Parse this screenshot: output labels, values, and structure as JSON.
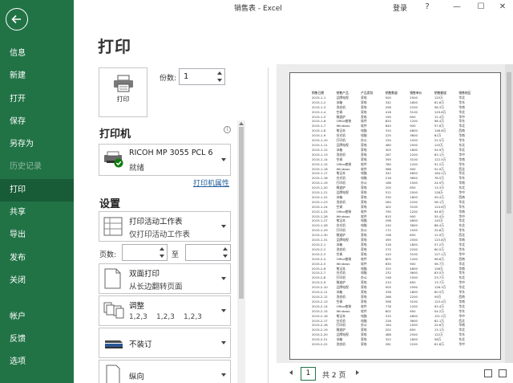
{
  "window": {
    "title": "销售表 - Excel",
    "login": "登录",
    "help": "?",
    "minimize": "—",
    "maximize": "☐",
    "close": "✕"
  },
  "nav": {
    "items": [
      {
        "label": "信息",
        "state": "normal"
      },
      {
        "label": "新建",
        "state": "normal"
      },
      {
        "label": "打开",
        "state": "normal"
      },
      {
        "label": "保存",
        "state": "normal"
      },
      {
        "label": "另存为",
        "state": "normal"
      },
      {
        "label": "历史记录",
        "state": "disabled"
      },
      {
        "label": "打印",
        "state": "active"
      },
      {
        "label": "共享",
        "state": "normal"
      },
      {
        "label": "导出",
        "state": "normal"
      },
      {
        "label": "发布",
        "state": "normal"
      },
      {
        "label": "关闭",
        "state": "normal"
      },
      {
        "label": "帐户",
        "state": "normal"
      },
      {
        "label": "反馈",
        "state": "normal"
      },
      {
        "label": "选项",
        "state": "normal"
      }
    ]
  },
  "print": {
    "heading": "打印",
    "button_label": "打印",
    "copies_label": "份数:",
    "copies_value": "1"
  },
  "printer": {
    "heading": "打印机",
    "info_glyph": "i",
    "name": "RICOH MP 3055 PCL 6",
    "status": "就绪",
    "properties_link": "打印机属性"
  },
  "settings": {
    "heading": "设置",
    "what": {
      "line1": "打印活动工作表",
      "line2": "仅打印活动工作表"
    },
    "pages_label": "页数:",
    "to_label": "至",
    "sides": {
      "line1": "双面打印",
      "line2": "从长边翻转页面"
    },
    "collate": {
      "line1": "调整",
      "nums": [
        "1,2,3",
        "1,2,3",
        "1,2,3"
      ]
    },
    "staple": {
      "line1": "不装订"
    },
    "orientation": {
      "line1": "纵向"
    }
  },
  "preview": {
    "current_page": "1",
    "total": "共 2 页",
    "headers": [
      "销售日期",
      "销售产品",
      "产品类别",
      "销售数量",
      "销售单价",
      "销售额度",
      "销售地区"
    ],
    "rows": [
      [
        "2015-1-1",
        "品牌电视",
        "家电",
        "500",
        "2500",
        "125万",
        "华北"
      ],
      [
        "2015-1-2",
        "冰箱",
        "家电",
        "342",
        "1800",
        "61.6万",
        "华东"
      ],
      [
        "2015-1-3",
        "洗衣机",
        "家电",
        "256",
        "2200",
        "56.3万",
        "华南"
      ],
      [
        "2015-1-4",
        "空调",
        "家电",
        "418",
        "3100",
        "129.6万",
        "华北"
      ],
      [
        "2015-1-5",
        "微波炉",
        "家电",
        "190",
        "650",
        "12.4万",
        "华中"
      ],
      [
        "2015-1-6",
        "Office套装",
        "软件",
        "820",
        "1200",
        "98.4万",
        "华东"
      ],
      [
        "2015-1-7",
        "Windows",
        "软件",
        "640",
        "900",
        "57.6万",
        "华北"
      ],
      [
        "2015-1-8",
        "笔记本",
        "电脑",
        "310",
        "4800",
        "148.8万",
        "西南"
      ],
      [
        "2015-1-9",
        "台式机",
        "电脑",
        "225",
        "3600",
        "81万",
        "华南"
      ],
      [
        "2015-1-10",
        "打印机",
        "办公",
        "150",
        "1500",
        "22.5万",
        "华东"
      ],
      [
        "2015-1-11",
        "品牌电视",
        "家电",
        "480",
        "2500",
        "120万",
        "东北"
      ],
      [
        "2015-1-12",
        "冰箱",
        "家电",
        "305",
        "1800",
        "54.9万",
        "华北"
      ],
      [
        "2015-1-13",
        "洗衣机",
        "家电",
        "287",
        "2200",
        "63.1万",
        "华中"
      ],
      [
        "2015-1-14",
        "空调",
        "家电",
        "395",
        "3100",
        "122.5万",
        "华南"
      ],
      [
        "2015-1-15",
        "Office套装",
        "软件",
        "760",
        "1200",
        "91.2万",
        "华东"
      ],
      [
        "2015-1-16",
        "Windows",
        "软件",
        "588",
        "900",
        "52.9万",
        "西北"
      ],
      [
        "2015-1-17",
        "笔记本",
        "电脑",
        "342",
        "4800",
        "164.2万",
        "华北"
      ],
      [
        "2015-1-18",
        "台式机",
        "电脑",
        "218",
        "3600",
        "78.5万",
        "华东"
      ],
      [
        "2015-1-19",
        "打印机",
        "办公",
        "166",
        "1500",
        "24.9万",
        "华南"
      ],
      [
        "2015-1-20",
        "微波炉",
        "家电",
        "205",
        "650",
        "13.3万",
        "东北"
      ],
      [
        "2015-1-21",
        "品牌电视",
        "家电",
        "512",
        "2500",
        "128万",
        "华中"
      ],
      [
        "2015-1-22",
        "冰箱",
        "家电",
        "330",
        "1800",
        "59.4万",
        "西南"
      ],
      [
        "2015-1-23",
        "洗衣机",
        "家电",
        "264",
        "2200",
        "58.1万",
        "华北"
      ],
      [
        "2015-1-24",
        "空调",
        "家电",
        "402",
        "3100",
        "124.6万",
        "华东"
      ],
      [
        "2015-1-25",
        "Office套装",
        "软件",
        "790",
        "1200",
        "94.8万",
        "华南"
      ],
      [
        "2015-1-26",
        "Windows",
        "软件",
        "615",
        "900",
        "55.4万",
        "华中"
      ],
      [
        "2015-1-27",
        "笔记本",
        "电脑",
        "298",
        "4800",
        "143万",
        "华北"
      ],
      [
        "2015-1-28",
        "台式机",
        "电脑",
        "240",
        "3600",
        "86.4万",
        "东北"
      ],
      [
        "2015-1-29",
        "打印机",
        "办公",
        "172",
        "1500",
        "25.8万",
        "华东"
      ],
      [
        "2015-1-30",
        "微波炉",
        "家电",
        "198",
        "650",
        "12.9万",
        "西北"
      ],
      [
        "2015-1-31",
        "品牌电视",
        "家电",
        "495",
        "2500",
        "123.8万",
        "华南"
      ],
      [
        "2015-2-1",
        "冰箱",
        "家电",
        "318",
        "1800",
        "57.2万",
        "华北"
      ],
      [
        "2015-2-2",
        "洗衣机",
        "家电",
        "275",
        "2200",
        "60.5万",
        "华东"
      ],
      [
        "2015-2-3",
        "空调",
        "家电",
        "410",
        "3100",
        "127.1万",
        "华中"
      ],
      [
        "2015-2-4",
        "Office套装",
        "软件",
        "805",
        "1200",
        "96.6万",
        "西南"
      ],
      [
        "2015-2-5",
        "Windows",
        "软件",
        "630",
        "900",
        "56.7万",
        "华北"
      ],
      [
        "2015-2-6",
        "笔记本",
        "电脑",
        "325",
        "4800",
        "156万",
        "华南"
      ],
      [
        "2015-2-7",
        "台式机",
        "电脑",
        "232",
        "3600",
        "83.5万",
        "华东"
      ],
      [
        "2015-2-8",
        "打印机",
        "办公",
        "158",
        "1500",
        "23.7万",
        "东北"
      ],
      [
        "2015-2-9",
        "微波炉",
        "家电",
        "210",
        "650",
        "13.7万",
        "华中"
      ],
      [
        "2015-2-10",
        "品牌电视",
        "家电",
        "505",
        "2500",
        "126.3万",
        "华北"
      ],
      [
        "2015-2-11",
        "冰箱",
        "家电",
        "336",
        "1800",
        "60.5万",
        "华东"
      ],
      [
        "2015-2-12",
        "洗衣机",
        "家电",
        "268",
        "2200",
        "59万",
        "西南"
      ],
      [
        "2015-2-13",
        "空调",
        "家电",
        "398",
        "3100",
        "123.4万",
        "华南"
      ],
      [
        "2015-2-14",
        "Office套装",
        "软件",
        "778",
        "1200",
        "93.4万",
        "华北"
      ],
      [
        "2015-2-15",
        "Windows",
        "软件",
        "602",
        "900",
        "54.2万",
        "华东"
      ],
      [
        "2015-2-16",
        "笔记本",
        "电脑",
        "315",
        "4800",
        "151.2万",
        "华中"
      ],
      [
        "2015-2-17",
        "台式机",
        "电脑",
        "228",
        "3600",
        "82.1万",
        "西北"
      ],
      [
        "2015-2-18",
        "打印机",
        "办公",
        "164",
        "1500",
        "24.6万",
        "华南"
      ],
      [
        "2015-2-19",
        "微波炉",
        "家电",
        "202",
        "650",
        "13.1万",
        "华北"
      ],
      [
        "2015-2-20",
        "品牌电视",
        "家电",
        "488",
        "2500",
        "122万",
        "华东"
      ],
      [
        "2015-2-21",
        "冰箱",
        "家电",
        "322",
        "1800",
        "58万",
        "东北"
      ],
      [
        "2015-2-22",
        "洗衣机",
        "家电",
        "281",
        "2200",
        "61.8万",
        "华中"
      ]
    ]
  }
}
